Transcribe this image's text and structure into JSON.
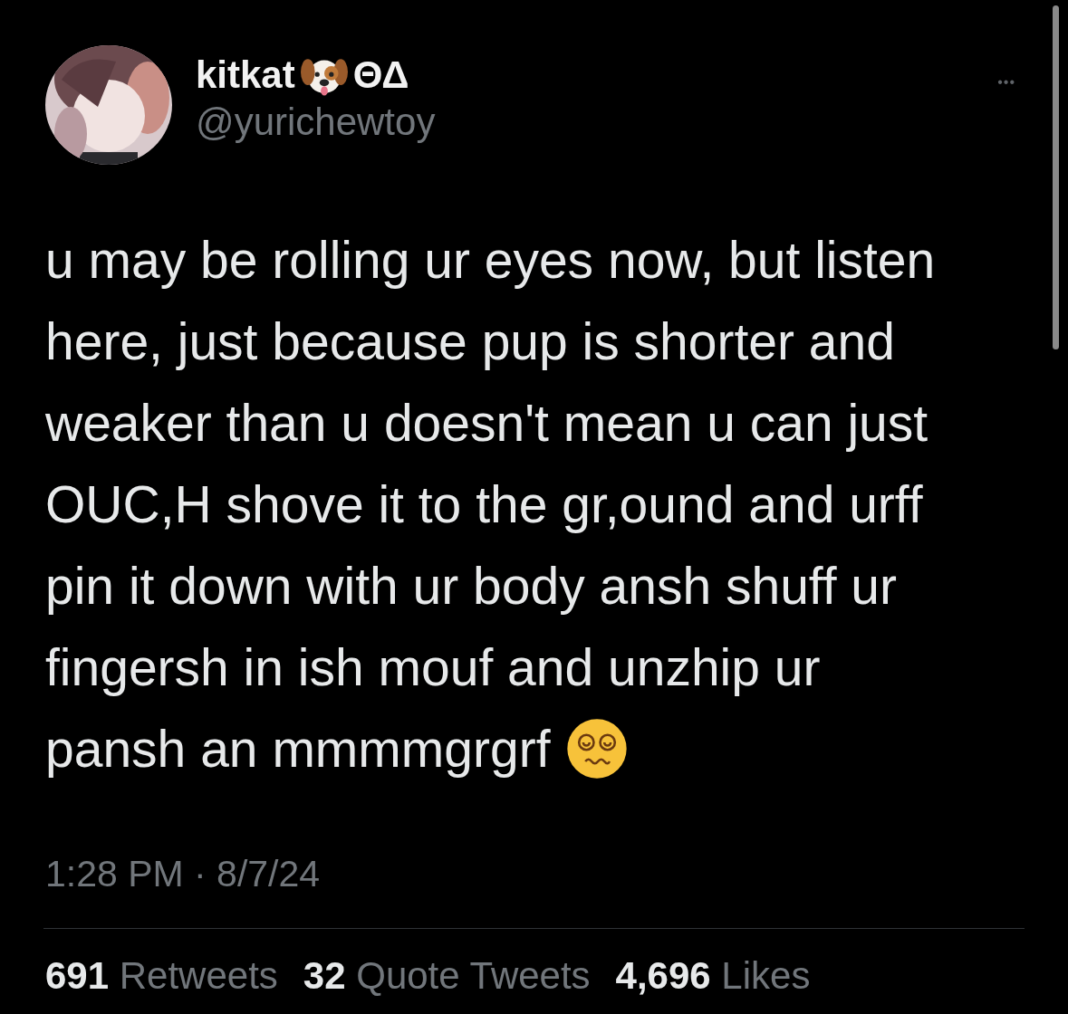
{
  "tweet": {
    "author": {
      "name": "kitkat",
      "badge": "ΘΔ",
      "handle": "@yurichewtoy"
    },
    "more": "•••",
    "text_lines": [
      "u may be rolling ur eyes now, but listen",
      "here, just because pup is shorter and",
      "weaker than u doesn't mean u can just",
      "OUC,H shove it to the gr,ound and urff",
      "pin it down with ur body ansh shuff ur",
      "fingersh in ish mouf and unzhip ur",
      "pansh an mmmmgrgrf"
    ],
    "timestamp": "1:28 PM · 8/7/24",
    "stats": [
      {
        "count": "691",
        "label": "Retweets"
      },
      {
        "count": "32",
        "label": "Quote Tweets"
      },
      {
        "count": "4,696",
        "label": "Likes"
      }
    ]
  }
}
